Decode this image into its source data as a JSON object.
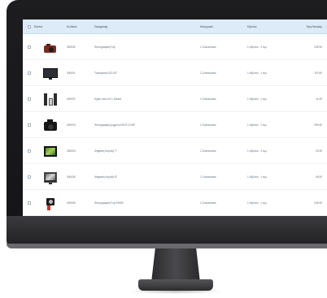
{
  "table": {
    "headers": {
      "image": "Εικόνα",
      "code": "Κωδικός",
      "description": "Περιγραφή",
      "category": "Κατηγορία",
      "unit": "Κιβώτιο",
      "price": "Τιμή Λιανικής"
    },
    "rows": [
      {
        "icon": "compact-camera-icon",
        "code": "000000",
        "description": "Φωτογραφική Fuji",
        "category": "1 Συσκευασία",
        "unit": "1 Κιβώτιο · 1 τεμ.",
        "price": "239,90"
      },
      {
        "icon": "tv-icon",
        "code": "000001",
        "description": "Τηλεόραση LED 42\"",
        "category": "1 Συσκευασία",
        "unit": "1 Κιβώτιο · 1 τεμ.",
        "price": "119,90"
      },
      {
        "icon": "speakers-icon",
        "code": "000002",
        "description": "Ηχεία Lenco 5.1 Sound",
        "category": "1 Συσκευασία",
        "unit": "1 Κιβώτιο · 1 τεμ.",
        "price": "11,90"
      },
      {
        "icon": "dslr-camera-icon",
        "code": "000003",
        "description": "Φωτογραφική μηχανή DSLR 12 MP",
        "category": "1 Συσκευασία",
        "unit": "1 Κιβώτιο · 1 τεμ.",
        "price": "299,90"
      },
      {
        "icon": "photo-frame-icon",
        "code": "000004",
        "description": "Ψηφιακή Κορνίζα 7\"",
        "category": "1 Συσκευασία",
        "unit": "1 Κιβώτιο · 1 τεμ.",
        "price": "22,90"
      },
      {
        "icon": "photo-frame-icon",
        "code": "000005",
        "description": "Ψηφιακή Κορνίζα 8\"",
        "category": "1 Συσκευασία",
        "unit": "1 Κιβώτιο · 1 τεμ.",
        "price": "49,90"
      },
      {
        "icon": "compact-camera-icon",
        "code": "000006",
        "description": "Φωτογραφική Fuji S2950",
        "category": "1 Συσκευασία",
        "unit": "1 Κιβώτιο · 1 τεμ.",
        "price": "249,90"
      }
    ]
  }
}
